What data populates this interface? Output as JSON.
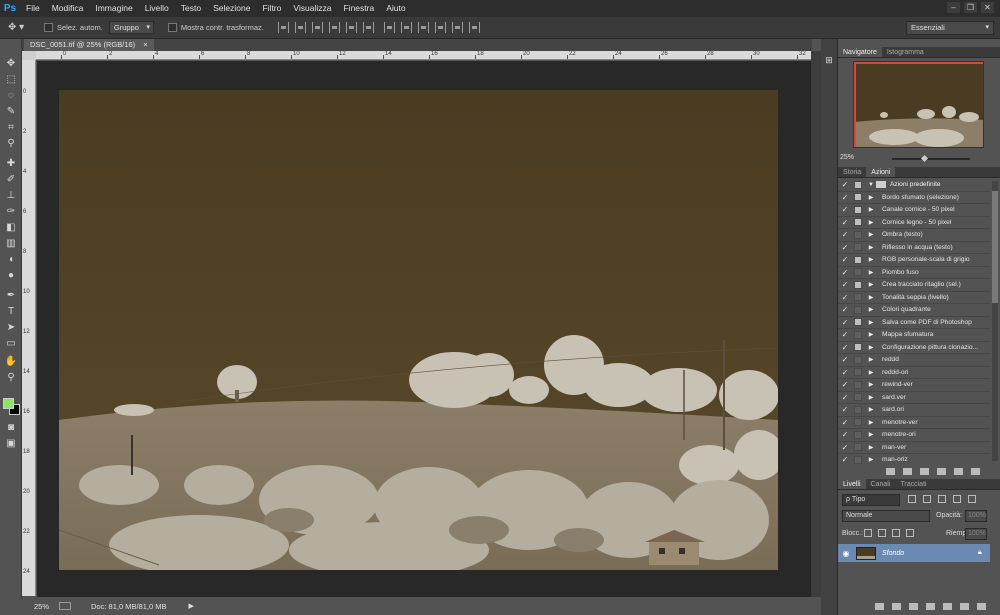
{
  "app": {
    "logo": "Ps"
  },
  "menu": [
    "File",
    "Modifica",
    "Immagine",
    "Livello",
    "Testo",
    "Selezione",
    "Filtro",
    "Visualizza",
    "Finestra",
    "Aiuto"
  ],
  "options_bar": {
    "auto_select_label": "Selez. autom.",
    "auto_select_value": "Gruppo",
    "transform_label": "Mostra contr. trasformaz.",
    "workspace": "Essenziali"
  },
  "document": {
    "tab_title": "DSC_0051.tif @ 25% (RGB/16)",
    "close_glyph": "×"
  },
  "rulers": {
    "top": [
      "0",
      "2",
      "4",
      "6",
      "8",
      "10",
      "12",
      "14",
      "16",
      "18",
      "20",
      "22",
      "24",
      "26",
      "28",
      "30",
      "32",
      "34"
    ],
    "left": [
      "0",
      "2",
      "4",
      "6",
      "8",
      "10",
      "12",
      "14",
      "16",
      "18",
      "20",
      "22",
      "24"
    ]
  },
  "status": {
    "zoom": "25%",
    "doc_info": "Doc: 81,0 MB/81,0 MB",
    "arrow": "▶"
  },
  "navigator": {
    "tabs": [
      "Navigatore",
      "Istogramma"
    ],
    "zoom": "25%"
  },
  "actions": {
    "tabs": [
      "Storia",
      "Azioni"
    ],
    "set_name": "Azioni predefinite",
    "items": [
      {
        "label": "Bordo sfumato (selezione)",
        "dialog": true
      },
      {
        "label": "Canale cornice - 50 pixel",
        "dialog": true
      },
      {
        "label": "Cornice legno - 50 pixel",
        "dialog": true
      },
      {
        "label": "Ombra (testo)",
        "dialog": false
      },
      {
        "label": "Riflesso in acqua (testo)",
        "dialog": false
      },
      {
        "label": "RGB personale-scala di grigio",
        "dialog": true
      },
      {
        "label": "Piombo fuso",
        "dialog": false
      },
      {
        "label": "Crea tracciato ritaglio (sel.)",
        "dialog": true
      },
      {
        "label": "Tonalità seppia (livello)",
        "dialog": false
      },
      {
        "label": "Colori quadrante",
        "dialog": false
      },
      {
        "label": "Salva come PDF di Photoshop",
        "dialog": true
      },
      {
        "label": "Mappa sfumatura",
        "dialog": false
      },
      {
        "label": "Configurazione pittura clonazio...",
        "dialog": true
      },
      {
        "label": "reddd",
        "dialog": false
      },
      {
        "label": "reddd-ori",
        "dialog": false
      },
      {
        "label": "rewind-ver",
        "dialog": false
      },
      {
        "label": "sard.ver",
        "dialog": false
      },
      {
        "label": "sard.ori",
        "dialog": false
      },
      {
        "label": "menotre-ver",
        "dialog": false
      },
      {
        "label": "menotre-ori",
        "dialog": false
      },
      {
        "label": "man-ver",
        "dialog": false
      },
      {
        "label": "man-oriz",
        "dialog": false
      }
    ]
  },
  "layers": {
    "tabs": [
      "Livelli",
      "Canali",
      "Tracciati"
    ],
    "filter": "ρ Tipo",
    "blend_mode": "Normale",
    "opacity_label": "Opacità:",
    "opacity_value": "100%",
    "lock_label": "Blocc.:",
    "fill_label": "Riemp.:",
    "fill_value": "100%",
    "layer_name": "Sfondo"
  },
  "colors": {
    "foreground": "#8fe266",
    "background": "#000000",
    "sky": "#4a3d22",
    "selected_layer": "#6b8ab2"
  }
}
